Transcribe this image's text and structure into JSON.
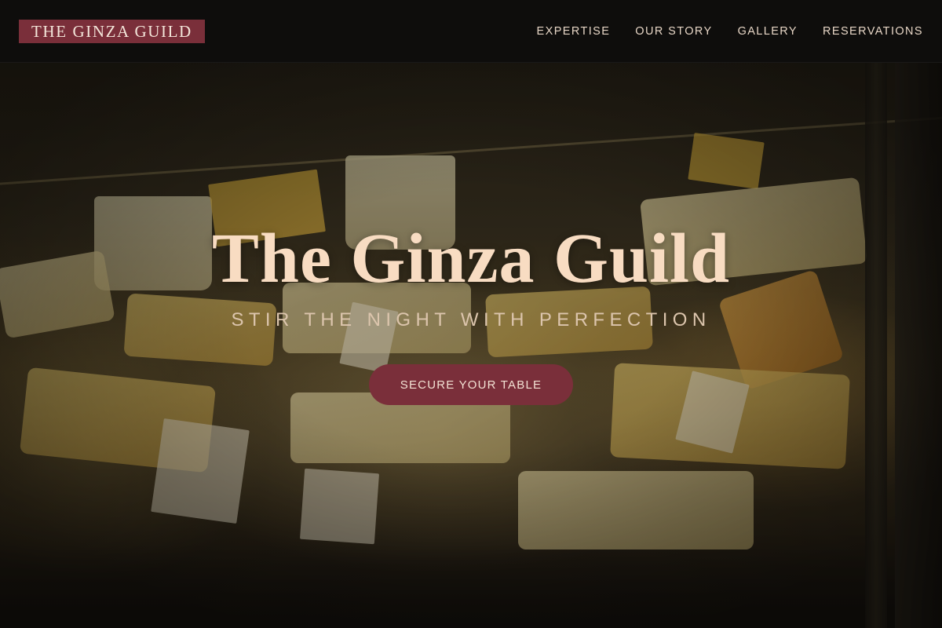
{
  "brand": {
    "logo_text": "THE GINZA GUILD"
  },
  "nav": {
    "items": [
      {
        "label": "EXPERTISE"
      },
      {
        "label": "OUR STORY"
      },
      {
        "label": "GALLERY"
      },
      {
        "label": "RESERVATIONS"
      }
    ]
  },
  "hero": {
    "title": "The Ginza Guild",
    "tagline": "STIR THE NIGHT WITH PERFECTION",
    "cta_label": "SECURE YOUR TABLE"
  },
  "colors": {
    "accent": "#7a2f3a",
    "title_text": "#f8dcc2",
    "nav_background": "#0e0d0c"
  }
}
